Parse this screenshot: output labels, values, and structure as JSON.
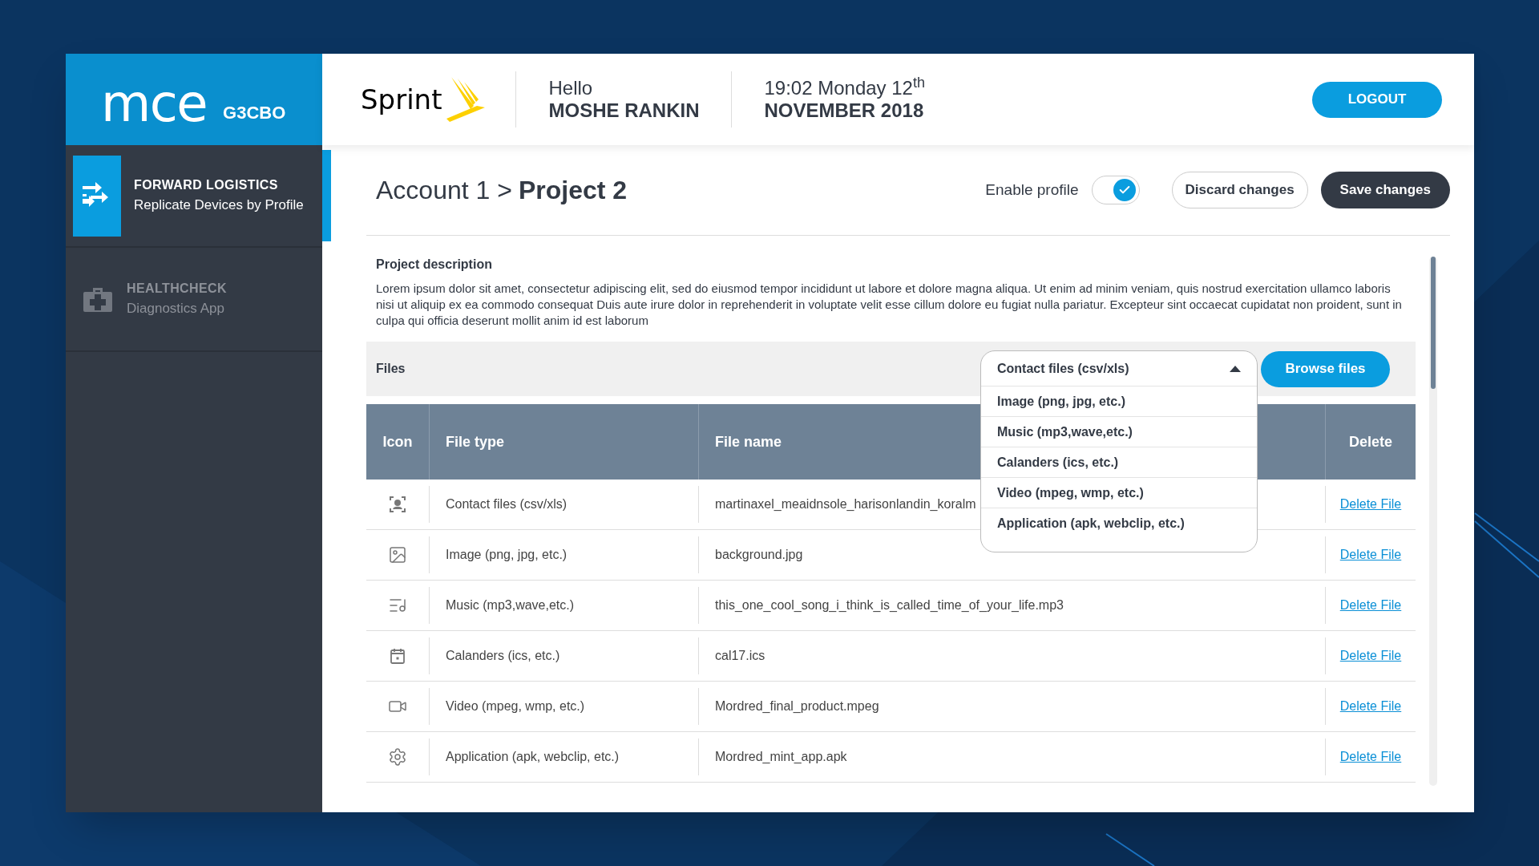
{
  "brand": {
    "logo": "mce",
    "code": "G3CBO"
  },
  "header": {
    "carrier": "Sprint",
    "greeting": "Hello",
    "user": "MOSHE RANKIN",
    "datetime": "19:02 Monday 12$^{th}$",
    "date": "NOVEMBER 2018",
    "logout": "LOGOUT"
  },
  "sidebar": {
    "items": [
      {
        "kind": "forward",
        "title": "FORWARD LOGISTICS",
        "subtitle": "Replicate Devices by Profile",
        "selected": true
      },
      {
        "kind": "health",
        "title": "HEALTHCHECK",
        "subtitle": "Diagnostics App",
        "selected": false
      }
    ]
  },
  "breadcrumb": {
    "parent": "Account 1 >",
    "current": "Project 2"
  },
  "enable_profile": {
    "label": "Enable profile",
    "on": true
  },
  "buttons": {
    "discard": "Discard changes",
    "save": "Save changes"
  },
  "description": {
    "title": "Project description",
    "text": "Lorem ipsum dolor sit amet, consectetur adipiscing elit, sed do eiusmod tempor incididunt ut labore et dolore magna aliqua. Ut enim ad minim veniam, quis nostrud exercitation ullamco laboris nisi ut aliquip ex ea commodo consequat Duis aute irure dolor in reprehenderit in voluptate velit esse cillum dolore eu fugiat nulla pariatur. Excepteur sint occaecat cupidatat non proident, sunt in culpa qui officia deserunt mollit anim id est laborum"
  },
  "files": {
    "label": "Files",
    "browse": "Browse files",
    "dropdown": {
      "value": "Contact files (csv/xls)",
      "expanded": true,
      "options": [
        "Image (png, jpg, etc.)",
        "Music (mp3,wave,etc.)",
        "Calanders (ics, etc.)",
        "Video (mpeg, wmp, etc.)",
        "Application (apk, webclip, etc.)"
      ]
    }
  },
  "table": {
    "columns": [
      "Icon",
      "File type",
      "File name",
      "Delete"
    ],
    "rows": [
      {
        "kind": "contact",
        "type": "Contact files (csv/xls)",
        "name": "martinaxel_meaidnsole_harisonlandin_koralm",
        "action": "Delete File"
      },
      {
        "kind": "image",
        "type": "Image (png, jpg, etc.)",
        "name": "background.jpg",
        "action": "Delete File"
      },
      {
        "kind": "music",
        "type": "Music (mp3,wave,etc.)",
        "name": "this_one_cool_song_i_think_is_called_time_of_your_life.mp3",
        "action": "Delete File"
      },
      {
        "kind": "calendar",
        "type": "Calanders (ics, etc.)",
        "name": "cal17.ics",
        "action": "Delete File"
      },
      {
        "kind": "video",
        "type": "Video (mpeg, wmp, etc.)",
        "name": "Mordred_final_product.mpeg",
        "action": "Delete File"
      },
      {
        "kind": "app",
        "type": "Application (apk, webclip, etc.)",
        "name": "Mordred_mint_app.apk",
        "action": "Delete File"
      }
    ]
  }
}
